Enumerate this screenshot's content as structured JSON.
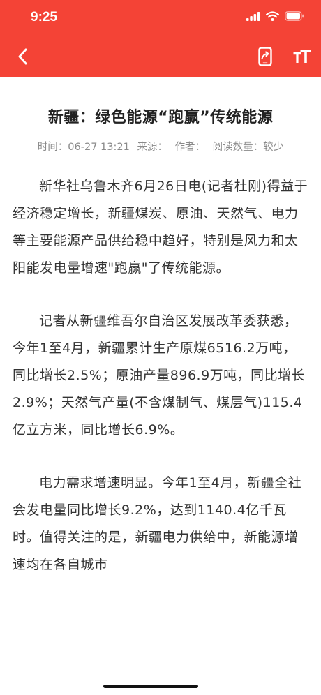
{
  "status_bar": {
    "time": "9:25"
  },
  "colors": {
    "header": "#f44336",
    "text": "#333333",
    "meta": "#8a8a8a"
  },
  "toolbar": {
    "back_icon": "chevron-left-icon",
    "share_icon": "share-phone-icon",
    "font_icon": "font-size-icon"
  },
  "article": {
    "title": "新疆：绿色能源“跑赢”传统能源",
    "meta": {
      "time": "时间：06-27 13:21",
      "source": "来源：",
      "author": "作者：",
      "reads": "阅读数量：较少"
    },
    "paragraphs": [
      "新华社乌鲁木齐6月26日电(记者杜刚)得益于经济稳定增长，新疆煤炭、原油、天然气、电力等主要能源产品供给稳中趋好，特别是风力和太阳能发电量增速\"跑赢\"了传统能源。",
      "记者从新疆维吾尔自治区发展改革委获悉，今年1至4月，新疆累计生产原煤6516.2万吨，同比增长2.5%；原油产量896.9万吨，同比增长2.9%；天然气产量(不含煤制气、煤层气)115.4亿立方米，同比增长6.9%。",
      "电力需求增速明显。今年1至4月，新疆全社会发电量同比增长9.2%，达到1140.4亿千瓦时。值得关注的是，新疆电力供给中，新能源增速均在各自城市"
    ]
  }
}
